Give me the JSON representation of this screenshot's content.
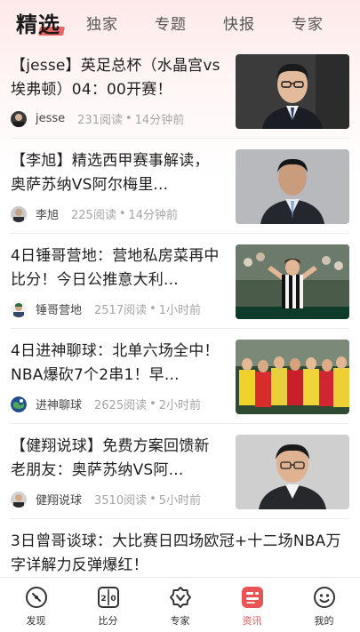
{
  "tabs": [
    {
      "label": "精选",
      "active": true
    },
    {
      "label": "独家",
      "active": false
    },
    {
      "label": "专题",
      "active": false
    },
    {
      "label": "快报",
      "active": false
    },
    {
      "label": "专家",
      "active": false
    }
  ],
  "articles": [
    {
      "title": "【jesse】英足总杯（水晶宫vs埃弗顿）04：00开赛！",
      "author": "jesse",
      "reads": "231阅读",
      "time": "14分钟前",
      "image": "man-in-suit-photo"
    },
    {
      "title": "【李旭】精选西甲赛事解读，奥萨苏纳VS阿尔梅里...",
      "author": "李旭",
      "reads": "225阅读",
      "time": "14分钟前",
      "image": "man-portrait-photo"
    },
    {
      "title": "4日锤哥营地：营地私房菜再中比分！今日公推意大利...",
      "author": "锤哥营地",
      "reads": "2517阅读",
      "time": "1小时前",
      "image": "footballer-celebrating-photo"
    },
    {
      "title": "4日进神聊球：北单六场全中！NBA爆砍7个2串1！早...",
      "author": "进神聊球",
      "reads": "2625阅读",
      "time": "2小时前",
      "image": "football-team-photo"
    },
    {
      "title": "【健翔说球】免费方案回馈新老朋友：奥萨苏纳VS阿...",
      "author": "健翔说球",
      "reads": "3510阅读",
      "time": "5小时前",
      "image": "man-glasses-photo"
    },
    {
      "title": "3日曾哥谈球：大比赛日四场欧冠+十二场NBA万字详解力反弹爆红！",
      "author": "",
      "reads": "",
      "time": ""
    }
  ],
  "separator": "•",
  "bottom_nav": [
    {
      "label": "发现",
      "icon": "discover-icon",
      "active": false
    },
    {
      "label": "比分",
      "icon": "score-icon",
      "active": false
    },
    {
      "label": "专家",
      "icon": "expert-badge-icon",
      "active": false
    },
    {
      "label": "资讯",
      "icon": "news-icon",
      "active": true
    },
    {
      "label": "我的",
      "icon": "profile-icon",
      "active": false
    }
  ],
  "colors": {
    "accent": "#e85454",
    "header_bg": "#fde9e9",
    "text_primary": "#1e1e1e",
    "text_meta": "#a6a6a6"
  }
}
